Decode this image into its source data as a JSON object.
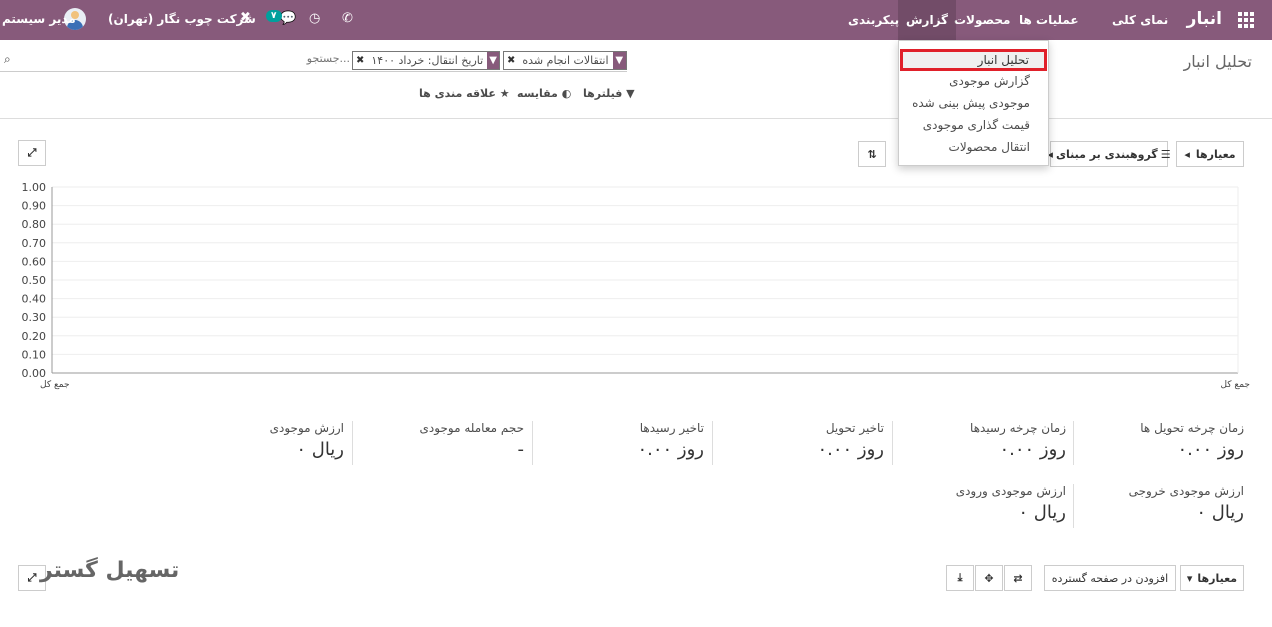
{
  "navbar": {
    "brand": "انبار",
    "menu": [
      "نمای کلی",
      "عملیات ها",
      "محصولات",
      "گزارش",
      "پیکربندی"
    ],
    "active_menu": "گزارش",
    "user": "مدیر سیستم",
    "company": "شرکت چوب نگار (تهران)",
    "message_count": "۷"
  },
  "breadcrumb": "تحلیل انبار",
  "search": {
    "placeholder": "جستجو...",
    "facets": [
      {
        "value": "انتقالات انجام شده"
      },
      {
        "value": "تاریخ انتقال: خرداد ۱۴۰۰"
      }
    ]
  },
  "options": {
    "filters": "فیلترها",
    "compare": "مقایسه",
    "favorites": "علاقه مندی ها"
  },
  "dropdown": {
    "items": [
      "تحلیل انبار",
      "گزارش موجودی",
      "موجودی پیش بینی شده",
      "قیمت گذاری موجودی",
      "انتقال محصولات"
    ],
    "highlighted": 0
  },
  "toolbar": {
    "measures": "معیارها",
    "group_by": "گروهبندی بر مبنای"
  },
  "chart_data": {
    "type": "line",
    "categories": [
      "جمع کل"
    ],
    "yticks": [
      "1.00",
      "0.90",
      "0.80",
      "0.70",
      "0.60",
      "0.50",
      "0.40",
      "0.30",
      "0.20",
      "0.10",
      "0.00"
    ],
    "ylim": [
      0,
      1
    ],
    "series": [],
    "grid": true
  },
  "kpis_row1": [
    {
      "label": "زمان چرخه تحویل ها",
      "value": "۰.۰۰ روز"
    },
    {
      "label": "زمان چرخه رسیدها",
      "value": "۰.۰۰ روز"
    },
    {
      "label": "تاخیر تحویل",
      "value": "۰.۰۰ روز"
    },
    {
      "label": "تاخیر رسیدها",
      "value": "۰.۰۰ روز"
    },
    {
      "label": "حجم معامله موجودی",
      "value": "-"
    },
    {
      "label": "ارزش موجودی",
      "value": "۰ ریال"
    }
  ],
  "kpis_row2": [
    {
      "label": "ارزش موجودی خروجی",
      "value": "۰ ریال"
    },
    {
      "label": "ارزش موجودی ورودی",
      "value": "۰ ریال"
    }
  ],
  "bottom_toolbar": {
    "measures": "معیارها",
    "add_to_dashboard": "افزودن در صفحه گسترده"
  },
  "watermark": "تسهیل گستر"
}
